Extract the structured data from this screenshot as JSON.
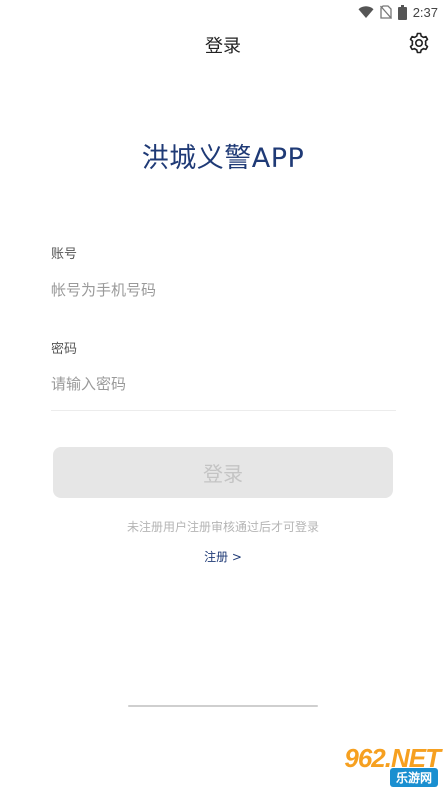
{
  "status_bar": {
    "time": "2:37",
    "icons": [
      "wifi-icon",
      "no-sim-icon",
      "battery-icon"
    ]
  },
  "header": {
    "title": "登录",
    "settings_icon": "gear-icon"
  },
  "app": {
    "name": "洪城义警APP"
  },
  "form": {
    "account": {
      "label": "账号",
      "placeholder": "帐号为手机号码",
      "value": ""
    },
    "password": {
      "label": "密码",
      "placeholder": "请输入密码",
      "value": ""
    },
    "login_label": "登录",
    "hint": "未注册用户注册审核通过后才可登录",
    "register_label": "注册 >"
  },
  "colors": {
    "brand": "#1f3a76",
    "button_disabled_bg": "#e6e6e6",
    "button_disabled_text": "#c4c4c4"
  },
  "watermark": {
    "top": "962.NET",
    "bottom": "乐游网"
  }
}
